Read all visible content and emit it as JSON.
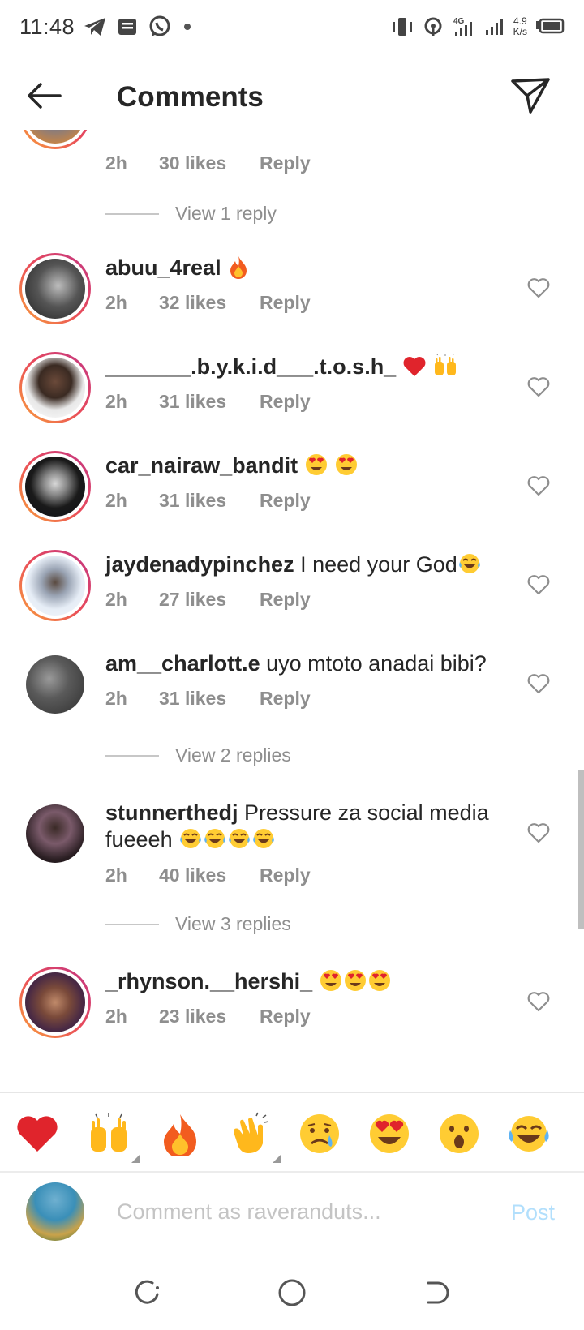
{
  "status_bar": {
    "time": "11:48",
    "network": "4G",
    "speed_value": "4.9",
    "speed_unit": "K/s"
  },
  "header": {
    "title": "Comments"
  },
  "top_partial": {
    "time": "2h",
    "likes": "30 likes",
    "reply": "Reply",
    "view_replies": "View 1 reply"
  },
  "comments": [
    {
      "username": "abuu_4real",
      "text": "",
      "emoji": [
        "fire"
      ],
      "time": "2h",
      "likes": "32 likes",
      "reply": "Reply"
    },
    {
      "username": "_______.b.y.k.i.d___.t.o.s.h_",
      "text": "",
      "emoji": [
        "red-heart",
        "raising-hands"
      ],
      "time": "2h",
      "likes": "31 likes",
      "reply": "Reply"
    },
    {
      "username": "car_nairaw_bandit",
      "text": "",
      "emoji": [
        "heart-eyes",
        "heart-eyes"
      ],
      "time": "2h",
      "likes": "31 likes",
      "reply": "Reply"
    },
    {
      "username": "jaydenadypinchez",
      "text": "I need your God",
      "emoji": [
        "tears-of-joy"
      ],
      "time": "2h",
      "likes": "27 likes",
      "reply": "Reply"
    },
    {
      "username": "am__charlott.e",
      "text": "uyo mtoto anadai bibi?",
      "emoji": [],
      "time": "2h",
      "likes": "31 likes",
      "reply": "Reply",
      "view_replies": "View 2 replies"
    },
    {
      "username": "stunnerthedj",
      "text": "Pressure za social media fueeeh",
      "emoji": [
        "tears-of-joy",
        "tears-of-joy",
        "tears-of-joy",
        "tears-of-joy"
      ],
      "time": "2h",
      "likes": "40 likes",
      "reply": "Reply",
      "view_replies": "View 3 replies"
    },
    {
      "username": "_rhynson.__hershi_",
      "text": "",
      "emoji": [
        "heart-eyes",
        "heart-eyes",
        "heart-eyes"
      ],
      "time": "2h",
      "likes": "23 likes",
      "reply": "Reply"
    }
  ],
  "quick_emojis": [
    "red-heart",
    "raising-hands",
    "fire",
    "clapping-hands",
    "crying-face",
    "heart-eyes",
    "surprised-face",
    "tears-of-joy"
  ],
  "composer": {
    "placeholder": "Comment as raveranduts...",
    "post_label": "Post"
  },
  "colors": {
    "accent": "#b2dffc",
    "meta": "#8e8e8e",
    "text": "#262626",
    "ring_start": "#f9a13a",
    "ring_end": "#c13584"
  }
}
